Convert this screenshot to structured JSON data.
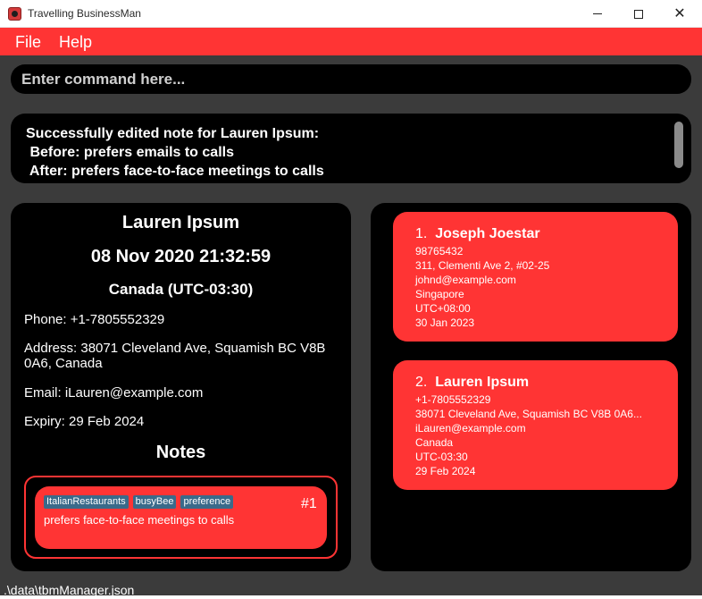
{
  "window": {
    "title": "Travelling BusinessMan",
    "icon": "app-icon"
  },
  "menu": {
    "file": "File",
    "help": "Help"
  },
  "command": {
    "placeholder": "Enter command here..."
  },
  "result": {
    "lines": [
      "Successfully edited note for Lauren Ipsum:",
      " Before: prefers emails to calls",
      " After: prefers face-to-face meetings to calls"
    ]
  },
  "detail": {
    "name": "Lauren Ipsum",
    "datetime": "08 Nov 2020 21:32:59",
    "timezone": "Canada (UTC-03:30)",
    "phone": "Phone: +1-7805552329",
    "address": "Address: 38071 Cleveland Ave, Squamish BC V8B 0A6, Canada",
    "email": "Email: iLauren@example.com",
    "expiry": "Expiry: 29 Feb 2024",
    "notes_title": "Notes",
    "notes": [
      {
        "tags": [
          "ItalianRestaurants",
          "busyBee",
          "preference"
        ],
        "index": "#1",
        "text": "prefers face-to-face meetings to calls"
      }
    ]
  },
  "contacts": [
    {
      "index": "1.",
      "name": "Joseph Joestar",
      "phone": "98765432",
      "address": "311, Clementi Ave 2, #02-25",
      "email": "johnd@example.com",
      "country": "Singapore",
      "timezone": "UTC+08:00",
      "date": "30 Jan 2023"
    },
    {
      "index": "2.",
      "name": "Lauren Ipsum",
      "phone": "+1-7805552329",
      "address": "38071 Cleveland Ave, Squamish BC V8B 0A6...",
      "email": "iLauren@example.com",
      "country": "Canada",
      "timezone": "UTC-03:30",
      "date": "29 Feb 2024"
    }
  ],
  "status": {
    "path": ".\\data\\tbmManager.json"
  },
  "colors": {
    "accent": "#ff3434",
    "panel": "#000000",
    "background": "#3b3b3b",
    "tag": "#3a6a8a"
  }
}
